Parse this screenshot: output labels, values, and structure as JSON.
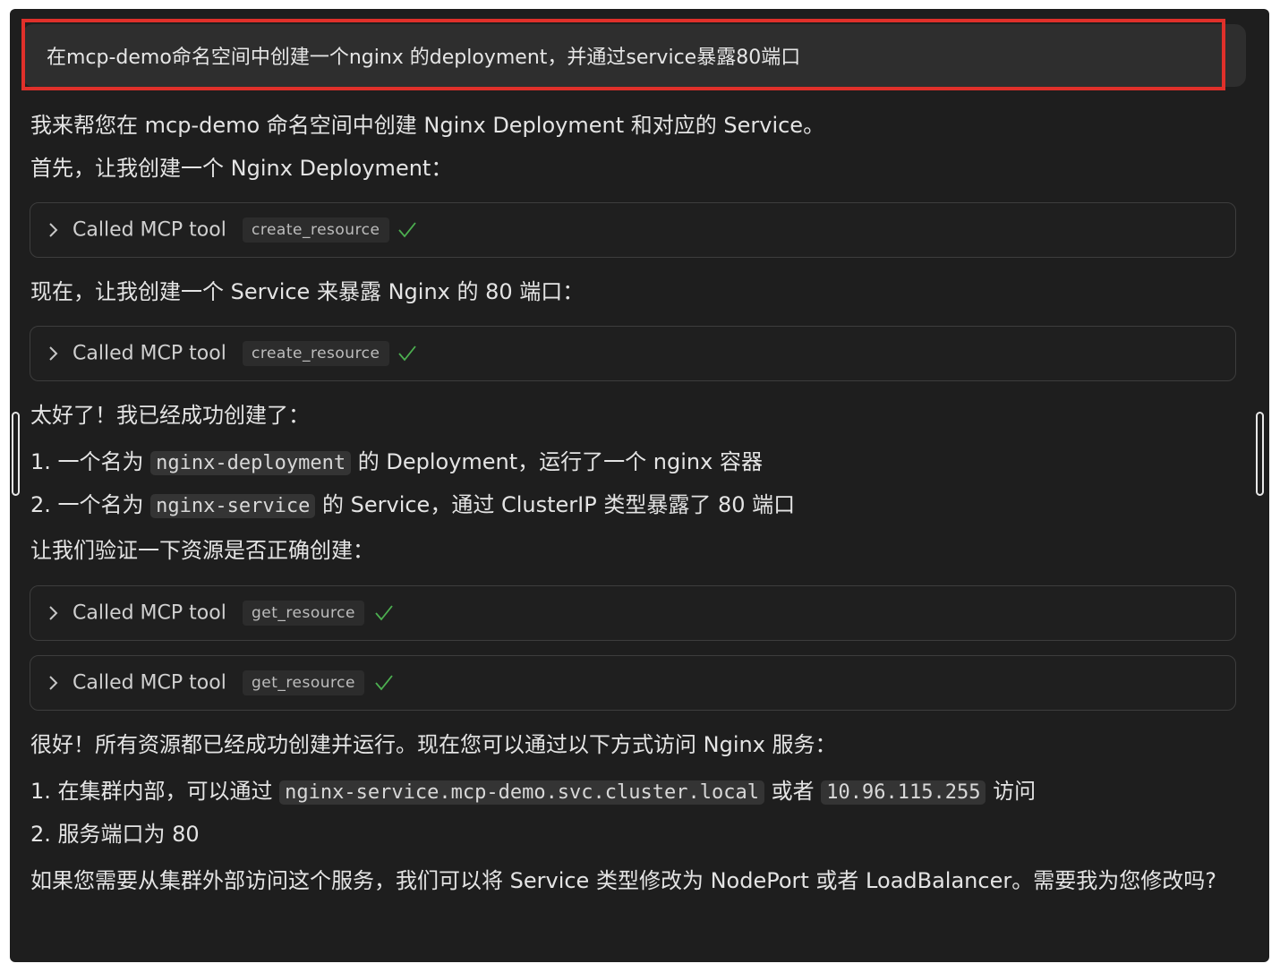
{
  "user_message": "在mcp-demo命名空间中创建一个nginx 的deployment，并通过service暴露80端口",
  "response": {
    "intro": "我来帮您在 mcp-demo 命名空间中创建 Nginx Deployment 和对应的 Service。",
    "step1": "首先，让我创建一个 Nginx Deployment：",
    "step2": "现在，让我创建一个 Service 来暴露 Nginx 的 80 端口：",
    "success": "太好了！我已经成功创建了：",
    "item1": {
      "prefix": "1. 一个名为",
      "code": "nginx-deployment",
      "suffix": "的 Deployment，运行了一个 nginx 容器"
    },
    "item2": {
      "prefix": "2. 一个名为",
      "code": "nginx-service",
      "suffix": "的 Service，通过 ClusterIP 类型暴露了 80 端口"
    },
    "verify": "让我们验证一下资源是否正确创建：",
    "final": "很好！所有资源都已经成功创建并运行。现在您可以通过以下方式访问 Nginx 服务：",
    "access1": {
      "prefix": "1. 在集群内部，可以通过",
      "code1": "nginx-service.mcp-demo.svc.cluster.local",
      "middle": "或者",
      "code2": "10.96.115.255",
      "suffix": "访问"
    },
    "access2": "2. 服务端口为 80",
    "closing": "如果您需要从集群外部访问这个服务，我们可以将 Service 类型修改为 NodePort 或者 LoadBalancer。需要我为您修改吗?"
  },
  "tool_calls": [
    {
      "label": "Called MCP tool",
      "name": "create_resource",
      "status": "success"
    },
    {
      "label": "Called MCP tool",
      "name": "create_resource",
      "status": "success"
    },
    {
      "label": "Called MCP tool",
      "name": "get_resource",
      "status": "success"
    },
    {
      "label": "Called MCP tool",
      "name": "get_resource",
      "status": "success"
    }
  ],
  "colors": {
    "background": "#1e1e1e",
    "highlight_border": "#e0302a",
    "check_color": "#4caf50"
  },
  "icons": [
    "chevron-right-icon",
    "check-icon"
  ]
}
